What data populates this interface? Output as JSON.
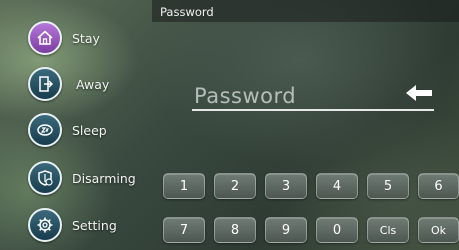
{
  "header": {
    "title": "Password"
  },
  "sidebar": {
    "items": [
      {
        "label": "Stay",
        "icon": "home-icon",
        "active": true
      },
      {
        "label": "Away",
        "icon": "door-exit-icon",
        "active": false
      },
      {
        "label": "Sleep",
        "icon": "sleep-icon",
        "active": false
      },
      {
        "label": "Disarming",
        "icon": "shield-icon",
        "active": false
      },
      {
        "label": "Setting",
        "icon": "gear-icon",
        "active": false
      }
    ]
  },
  "password": {
    "placeholder": "Password"
  },
  "keypad": {
    "row1": [
      "1",
      "2",
      "3",
      "4",
      "5",
      "6"
    ],
    "row2": [
      "7",
      "8",
      "9",
      "0",
      "Cls",
      "Ok"
    ]
  },
  "colors": {
    "active_icon": "#9b59c6",
    "icon_bg": "#1f4a5c"
  }
}
